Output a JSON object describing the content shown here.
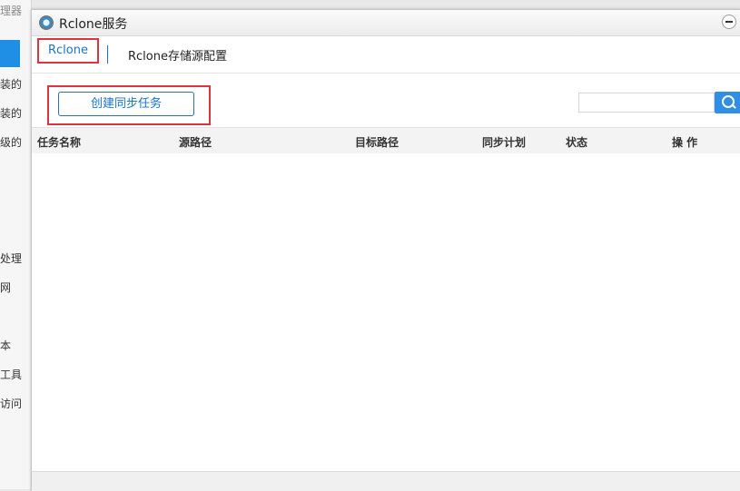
{
  "background_app": {
    "title_partial": "理器",
    "items": [
      "装的",
      "装的",
      "级的",
      "处理",
      "网",
      "本",
      "工具",
      "访问"
    ]
  },
  "window": {
    "title": "Rclone服务",
    "icon": "rclone-app-icon"
  },
  "tabs": [
    {
      "label": "Rclone",
      "active": true
    },
    {
      "label": "Rclone存储源配置",
      "active": false
    }
  ],
  "toolbar": {
    "create_label": "创建同步任务",
    "search_value": "",
    "search_placeholder": ""
  },
  "table": {
    "columns": [
      "任务名称",
      "源路径",
      "目标路径",
      "同步计划",
      "状态",
      "操 作"
    ],
    "rows": []
  },
  "colors": {
    "accent": "#1a73c8",
    "highlight_border": "#d9363e",
    "search_button": "#2f8ee6"
  }
}
